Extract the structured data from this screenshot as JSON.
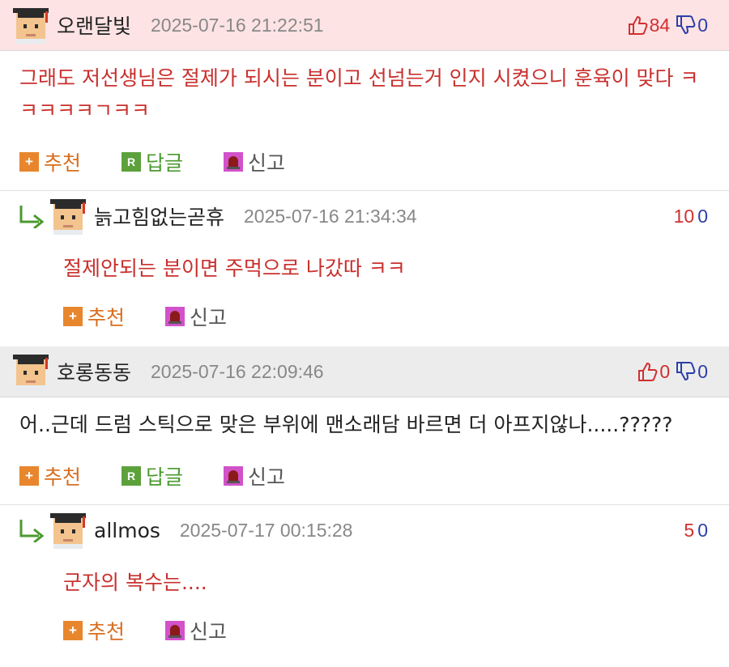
{
  "comments": [
    {
      "nick": "오랜달빛",
      "date": "2025-07-16 21:22:51",
      "up": "84",
      "down": "0",
      "text": "그래도 저선생님은 절제가 되시는 분이고 선넘는거 인지 시켰으니 훈육이 맞다 ㅋㅋㅋㅋㅋㄱㅋㅋ",
      "actions": {
        "recommend": "추천",
        "reply": "답글",
        "report": "신고"
      }
    },
    {
      "nick": "늙고힘없는곧휴",
      "date": "2025-07-16 21:34:34",
      "up": "10",
      "down": "0",
      "text": "절제안되는 분이면 주먹으로 나갔따 ㅋㅋ",
      "actions": {
        "recommend": "추천",
        "report": "신고"
      }
    },
    {
      "nick": "호롱동동",
      "date": "2025-07-16 22:09:46",
      "up": "0",
      "down": "0",
      "text": "어..근데 드럼 스틱으로 맞은 부위에 맨소래담 바르면 더 아프지않나.....?????",
      "actions": {
        "recommend": "추천",
        "reply": "답글",
        "report": "신고"
      }
    },
    {
      "nick": "allmos",
      "date": "2025-07-17 00:15:28",
      "up": "5",
      "down": "0",
      "text": "군자의 복수는....",
      "actions": {
        "recommend": "추천",
        "report": "신고"
      }
    }
  ],
  "icons": [
    "avatar-icon",
    "thumbs-up-icon",
    "thumbs-down-icon",
    "reply-arrow-icon",
    "plus-icon",
    "r-icon",
    "report-siren-icon"
  ],
  "colors": {
    "pink_header": "#fde3e4",
    "gray_header": "#ececec",
    "red_text": "#c8302e",
    "blue_count": "#2d3fa8"
  }
}
